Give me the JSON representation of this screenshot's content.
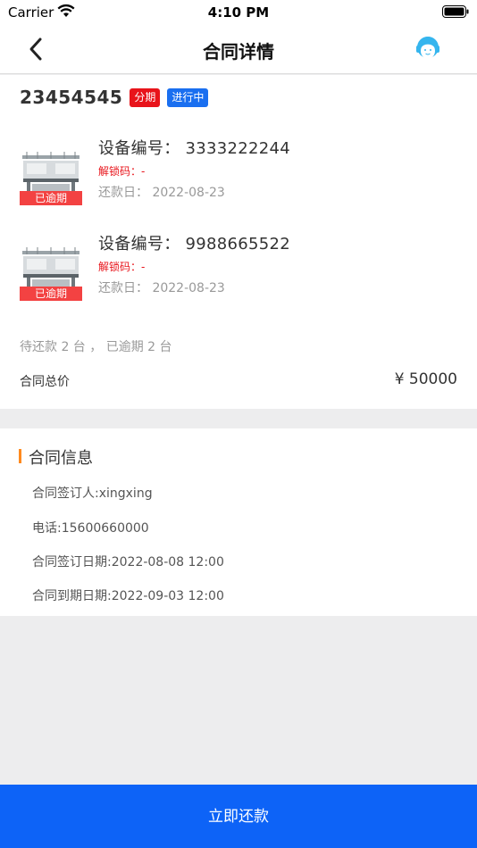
{
  "status_bar": {
    "carrier": "Carrier",
    "time": "4:10 PM"
  },
  "nav": {
    "title": "合同详情",
    "back_icon": "chevron-left-icon",
    "service_icon": "customer-service-icon"
  },
  "contract": {
    "number": "23454545",
    "tags": [
      {
        "label": "分期",
        "color": "#e8141b"
      },
      {
        "label": "进行中",
        "color": "#1a6ff0"
      }
    ],
    "devices": [
      {
        "code": "设备编号：  3333222244",
        "unlock": "解锁码：-",
        "due": "还款日：  2022-08-23",
        "overdue_label": "已逾期"
      },
      {
        "code": "设备编号：  9988665522",
        "unlock": "解锁码：-",
        "due": "还款日：  2022-08-23",
        "overdue_label": "已逾期"
      }
    ],
    "summary": "待还款  2  台  ，  已逾期  2  台",
    "total_label": "合同总价",
    "total_value": "¥  50000"
  },
  "info": {
    "title": "合同信息",
    "accent_color": "#ff8a1e",
    "signer": "合同签订人:xingxing",
    "phone": "电话:15600660000",
    "sign_date": "合同签订日期:2022-08-08 12:00",
    "expire_date": "合同到期日期:2022-09-03 12:00"
  },
  "footer": {
    "pay_button_label": "立即还款",
    "button_color": "#0d63f7"
  }
}
